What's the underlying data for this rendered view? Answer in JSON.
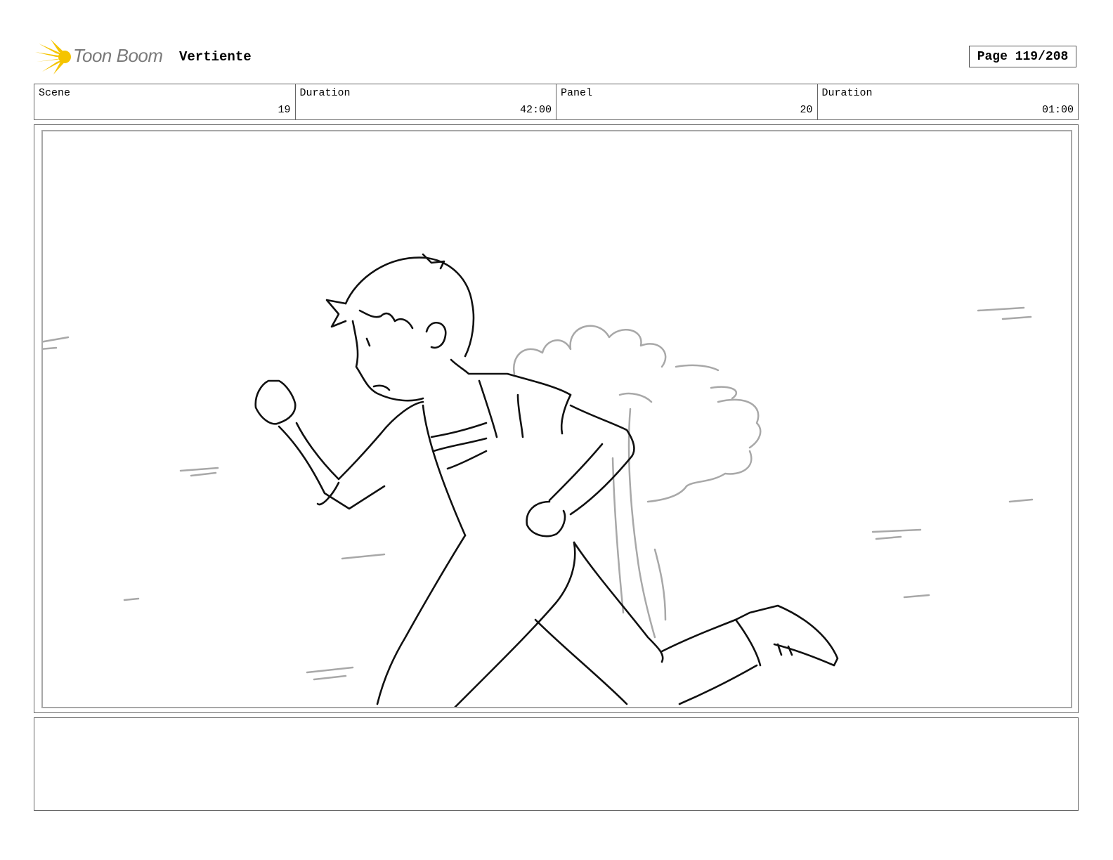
{
  "header": {
    "logo_text": "Toon Boom",
    "logo_icon": "burst-icon",
    "project_title": "Vertiente",
    "page_label": "Page 119/208"
  },
  "info": {
    "scene_label": "Scene",
    "scene_value": "19",
    "scene_duration_label": "Duration",
    "scene_duration_value": "42:00",
    "panel_label": "Panel",
    "panel_value": "20",
    "panel_duration_label": "Duration",
    "panel_duration_value": "01:00"
  },
  "colors": {
    "logo_yellow": "#f5c400",
    "logo_gray": "#7a7a7a",
    "sketch_black": "#111111",
    "sketch_gray": "#a8a8a8"
  },
  "panel": {
    "image_icon": "sketch-running-boy-icon"
  },
  "notes": {
    "text": ""
  }
}
